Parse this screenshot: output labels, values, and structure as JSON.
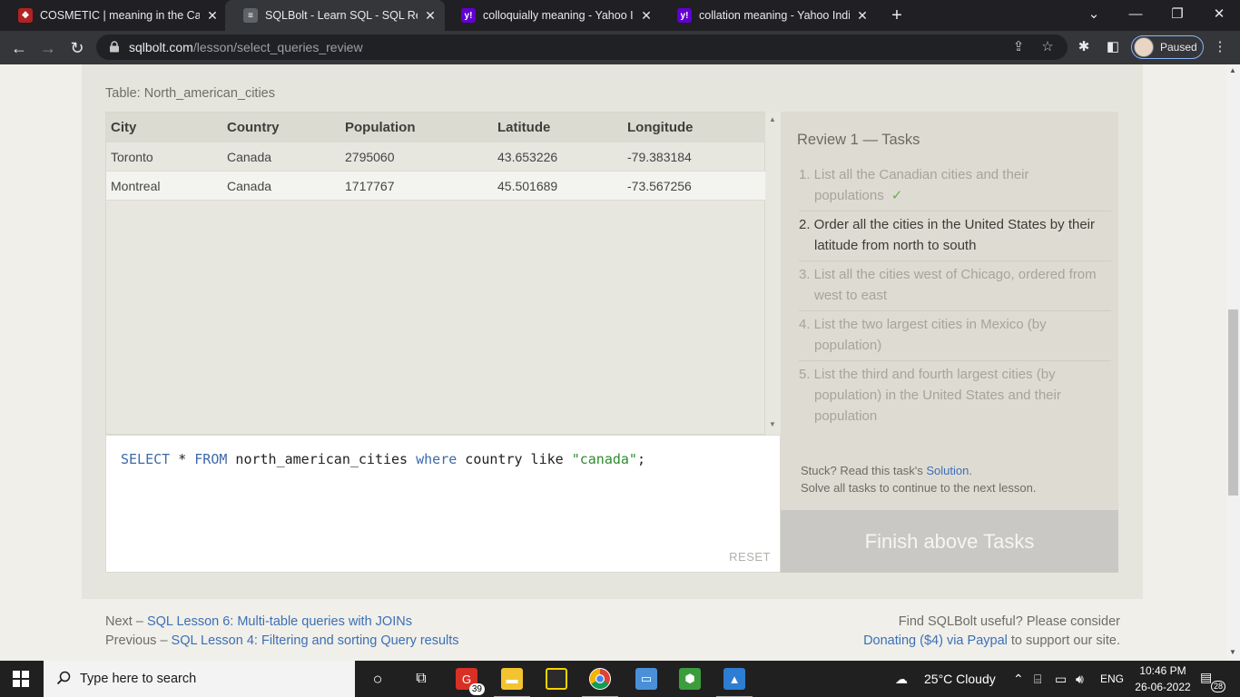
{
  "browser": {
    "tabs": [
      {
        "title": "COSMETIC | meaning in the Cambridge",
        "favicon": "cambridge-icon",
        "active": false
      },
      {
        "title": "SQLBolt - Learn SQL - SQL Review",
        "favicon": "database-icon",
        "active": true
      },
      {
        "title": "colloquially meaning - Yahoo India",
        "favicon": "yahoo-icon",
        "active": false
      },
      {
        "title": "collation meaning - Yahoo India Search",
        "favicon": "yahoo-icon",
        "active": false
      }
    ],
    "url_domain": "sqlbolt.com",
    "url_path": "/lesson/select_queries_review",
    "profile_status": "Paused"
  },
  "table": {
    "caption": "Table: North_american_cities",
    "columns": [
      "City",
      "Country",
      "Population",
      "Latitude",
      "Longitude"
    ],
    "rows": [
      [
        "Toronto",
        "Canada",
        "2795060",
        "43.653226",
        "-79.383184"
      ],
      [
        "Montreal",
        "Canada",
        "1717767",
        "45.501689",
        "-73.567256"
      ]
    ]
  },
  "editor": {
    "query_parts": {
      "select": "SELECT",
      "star": " * ",
      "from": "FROM",
      "table": " north_american_cities ",
      "where": "where",
      "rest": " country like ",
      "string": "\"canada\"",
      "end": ";"
    },
    "reset_label": "RESET"
  },
  "tasks": {
    "heading": "Review 1 — Tasks",
    "items": [
      {
        "text": "1. List all the Canadian cities and their populations",
        "done": true,
        "check": "✓"
      },
      {
        "text": "2. Order all the cities in the United States by their latitude from north to south",
        "done": false
      },
      {
        "text": "3. List all the cities west of Chicago, ordered from west to east",
        "done": false
      },
      {
        "text": "4. List the two largest cities in Mexico (by population)",
        "done": false
      },
      {
        "text": "5. List the third and fourth largest cities (by population) in the United States and their population",
        "done": false
      }
    ],
    "stuck_prefix": "Stuck? Read this task's ",
    "solution_link": "Solution",
    "stuck_suffix": ".",
    "solve_all": "Solve all tasks to continue to the next lesson.",
    "finish_button": "Finish above Tasks"
  },
  "footer": {
    "next_prefix": "Next – ",
    "next_link": "SQL Lesson 6: Multi-table queries with JOINs",
    "prev_prefix": "Previous – ",
    "prev_link": "SQL Lesson 4: Filtering and sorting Query results",
    "support_line1": "Find SQLBolt useful? Please consider",
    "support_link": "Donating ($4) via Paypal",
    "support_suffix": " to support our site."
  },
  "taskbar": {
    "search_placeholder": "Type here to search",
    "mail_badge": "39",
    "weather": "25°C  Cloudy",
    "language": "ENG",
    "time": "10:46 PM",
    "date": "26-06-2022",
    "notifications": "28"
  }
}
